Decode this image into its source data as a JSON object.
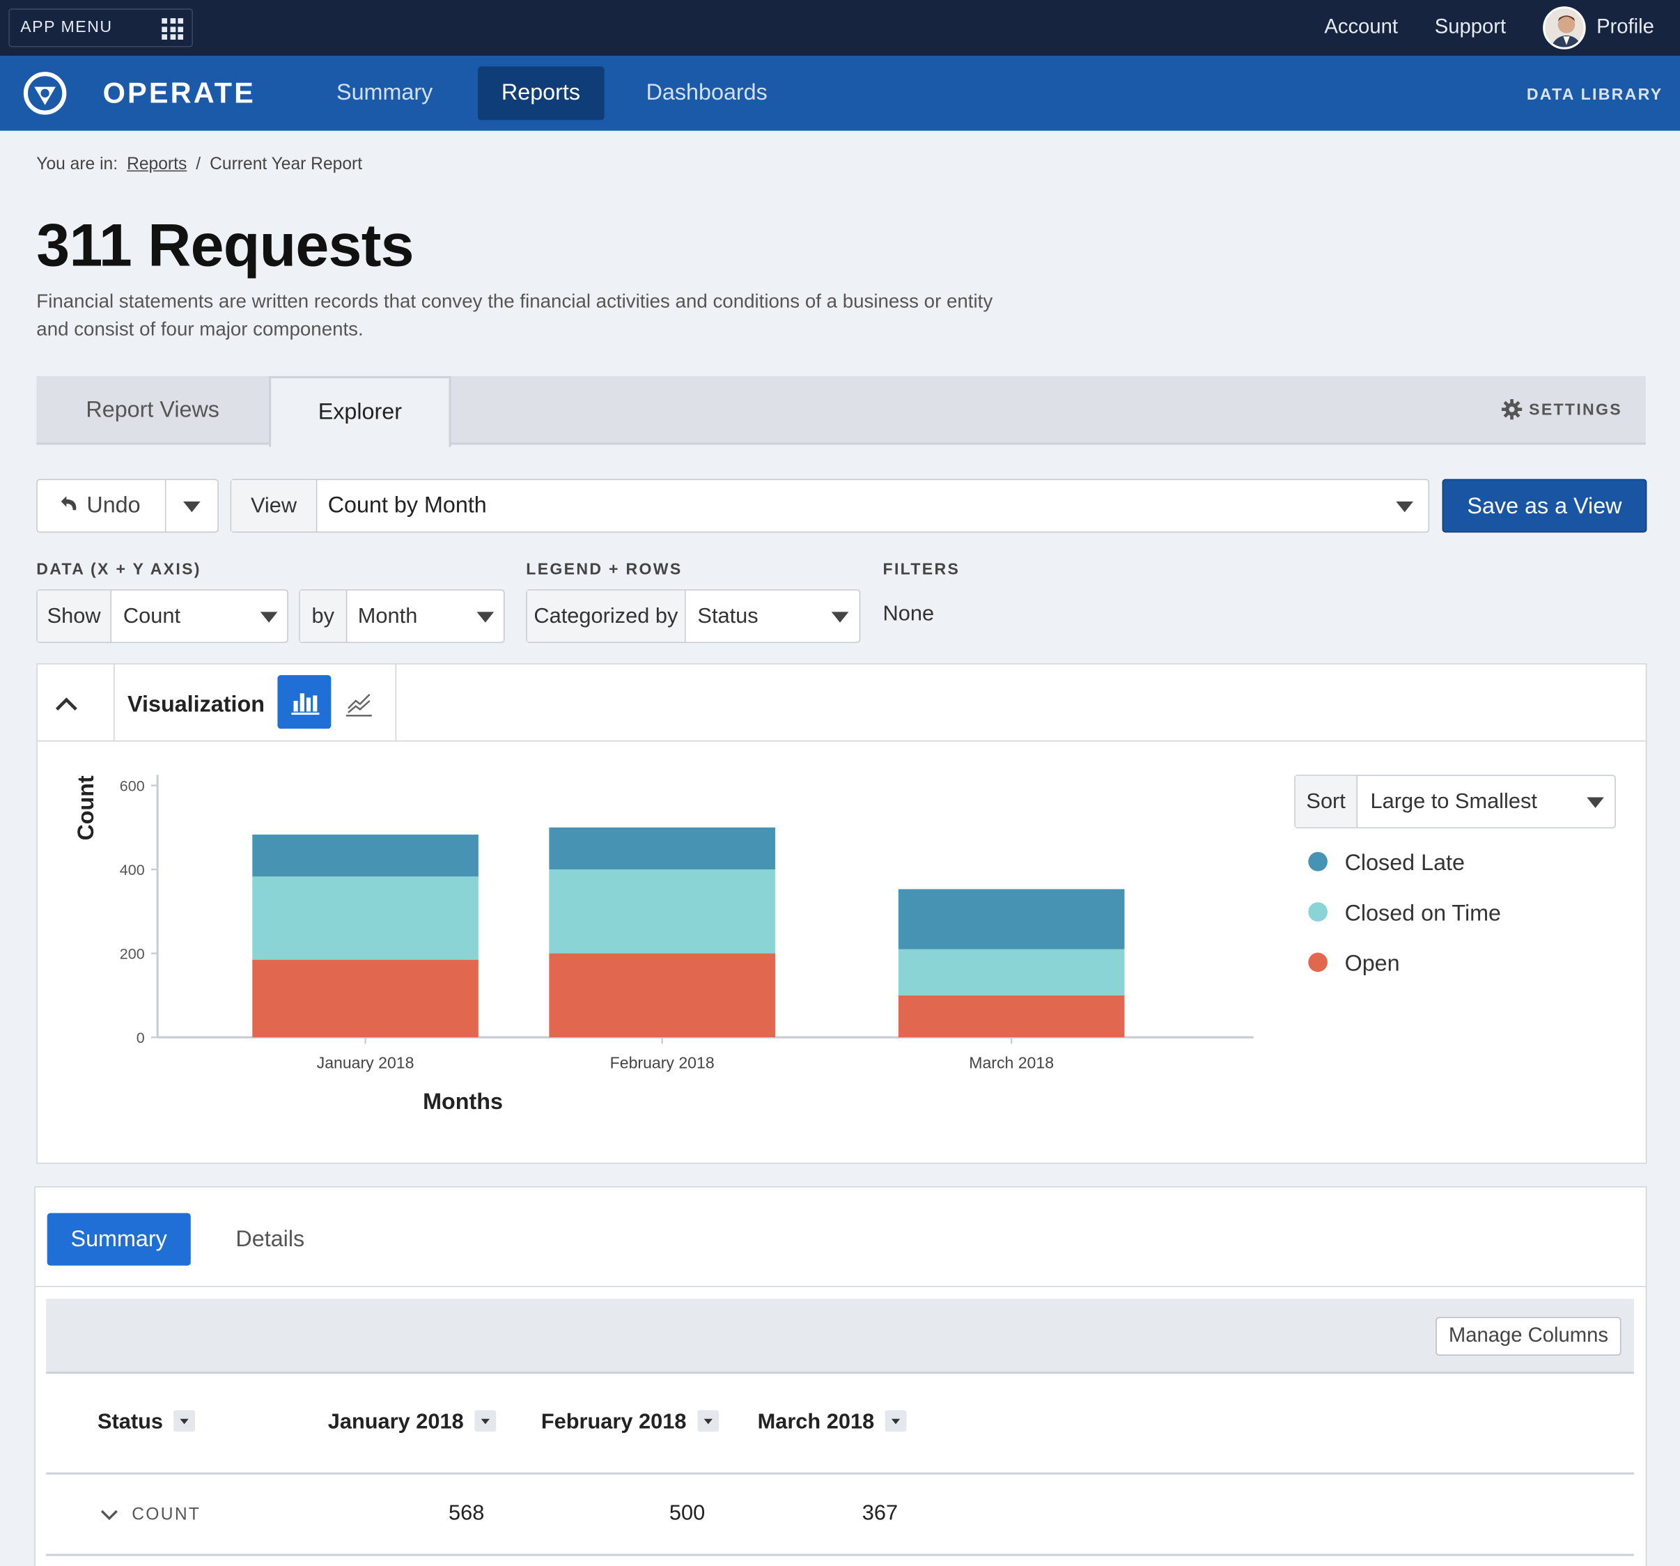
{
  "topbar": {
    "app_menu_label": "APP MENU",
    "links": [
      "Account",
      "Support",
      "Profile"
    ]
  },
  "nav": {
    "brand": "OPERATE",
    "tabs": [
      {
        "label": "Summary",
        "active": false
      },
      {
        "label": "Reports",
        "active": true
      },
      {
        "label": "Dashboards",
        "active": false
      }
    ],
    "data_library": "DATA LIBRARY"
  },
  "breadcrumb": {
    "prefix": "You are in:",
    "link": "Reports",
    "separator": "/",
    "current": "Current Year Report"
  },
  "page": {
    "title": "311 Requests",
    "description": "Financial statements are written records that convey the financial activities and conditions of a business or entity and consist of four major components."
  },
  "tabs": {
    "items": [
      "Report Views",
      "Explorer"
    ],
    "active": "Explorer",
    "settings_label": "SETTINGS"
  },
  "toolbar": {
    "undo_label": "Undo",
    "view_label": "View",
    "view_value": "Count by Month",
    "save_label": "Save as a View"
  },
  "config": {
    "data_label": "DATA (X + Y AXIS)",
    "show_prefix": "Show",
    "show_value": "Count",
    "by_prefix": "by",
    "by_value": "Month",
    "legend_label": "LEGEND + ROWS",
    "categorized_prefix": "Categorized by",
    "categorized_value": "Status",
    "filters_label": "FILTERS",
    "filters_value": "None"
  },
  "visualization": {
    "title": "Visualization",
    "sort_prefix": "Sort",
    "sort_value": "Large to Smallest",
    "icons": [
      "chevron-up-icon",
      "bar-chart-icon",
      "line-chart-icon"
    ]
  },
  "chart_data": {
    "type": "bar",
    "stacked": true,
    "categories": [
      "January 2018",
      "February 2018",
      "March 2018"
    ],
    "series": [
      {
        "name": "Open",
        "color": "#e1684f",
        "values": [
          185,
          200,
          100
        ]
      },
      {
        "name": "Closed on Time",
        "color": "#8bd4d6",
        "values": [
          198,
          200,
          110
        ]
      },
      {
        "name": "Closed Late",
        "color": "#4793b3",
        "values": [
          100,
          100,
          143
        ]
      }
    ],
    "ylim": [
      0,
      600
    ],
    "yticks": [
      0,
      200,
      400,
      600
    ],
    "xlabel": "Months",
    "ylabel": "Count",
    "legend_order": [
      "Closed Late",
      "Closed on Time",
      "Open"
    ],
    "legend_position": "right"
  },
  "summary": {
    "tabs": [
      "Summary",
      "Details"
    ],
    "active_tab": "Summary",
    "manage_columns": "Manage Columns",
    "columns": [
      "Status",
      "January 2018",
      "February 2018",
      "March 2018"
    ],
    "rows": [
      {
        "label": "COUNT",
        "values": [
          "568",
          "500",
          "367"
        ]
      }
    ]
  }
}
